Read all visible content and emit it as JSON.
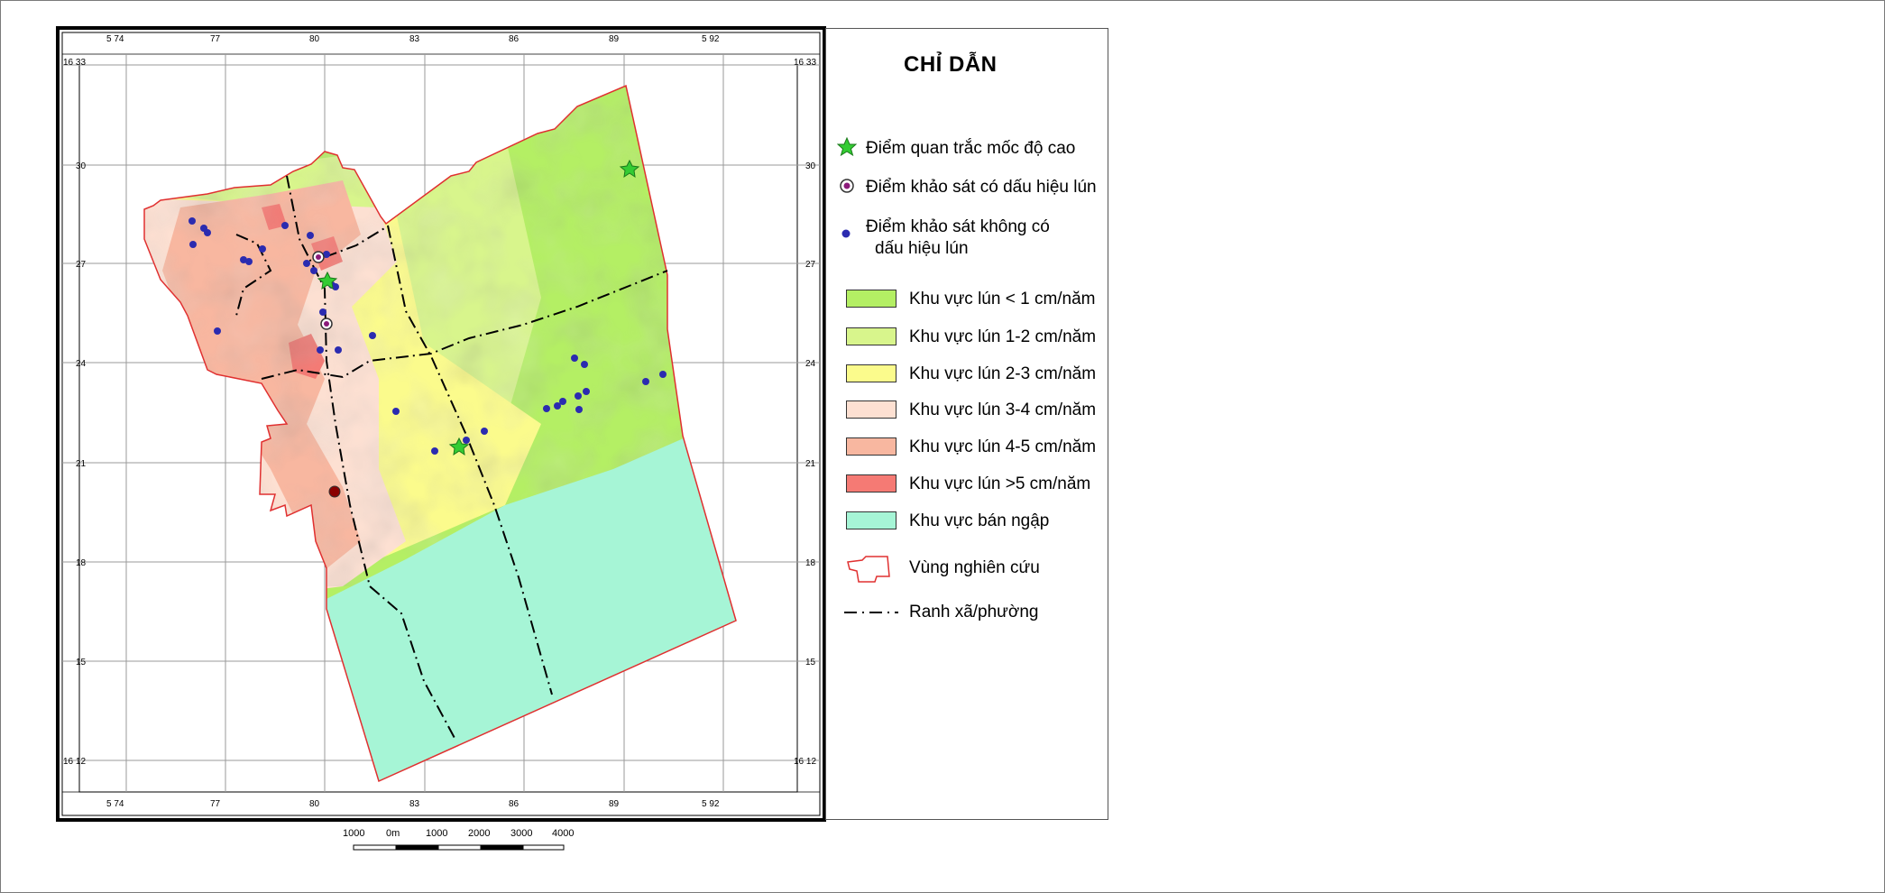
{
  "map": {
    "top_ticks": [
      "5 74",
      "77",
      "80",
      "83",
      "86",
      "89",
      "5 92"
    ],
    "bottom_ticks": [
      "5 74",
      "77",
      "80",
      "83",
      "86",
      "89",
      "5 92"
    ],
    "left_ticks": [
      "16 33",
      "30",
      "27",
      "24",
      "21",
      "18",
      "15",
      "16 12"
    ],
    "right_ticks": [
      "16 33",
      "30",
      "27",
      "24",
      "21",
      "18",
      "15",
      "16 12"
    ]
  },
  "legend": {
    "title": "CHỈ DẪN",
    "items": [
      {
        "label": "Điểm quan trắc mốc độ cao",
        "icon": "green-star-icon",
        "color": "#33cc33"
      },
      {
        "label": "Điểm khảo sát có dấu hiệu lún",
        "icon": "purple-ring-icon",
        "color": "#8b1a7a"
      },
      {
        "label": "Điểm khảo sát không có",
        "label2": "dấu hiệu lún",
        "icon": "blue-dot-icon",
        "color": "#2b2bb0"
      },
      {
        "label": "Khu vực lún < 1 cm/năm",
        "color": "#b4ef64"
      },
      {
        "label": "Khu vực lún 1-2 cm/năm",
        "color": "#d8f58c"
      },
      {
        "label": "Khu vực lún 2-3 cm/năm",
        "color": "#fbfb8c"
      },
      {
        "label": "Khu vực lún 3-4 cm/năm",
        "color": "#fde0d2"
      },
      {
        "label": "Khu vực lún 4-5 cm/năm",
        "color": "#f8b7a0"
      },
      {
        "label": "Khu vực lún >5 cm/năm",
        "color": "#f57a74"
      },
      {
        "label": "Khu vực bán ngập",
        "color": "#a6f5d6"
      },
      {
        "label": "Vùng nghiên cứu",
        "icon": "study-area-outline-icon",
        "color": "#e03030"
      },
      {
        "label": "Ranh xã/phường",
        "icon": "boundary-dashdot-icon",
        "color": "#000000"
      }
    ]
  },
  "scale": {
    "labels": [
      "1000",
      "0m",
      "1000",
      "2000",
      "3000",
      "4000"
    ]
  }
}
